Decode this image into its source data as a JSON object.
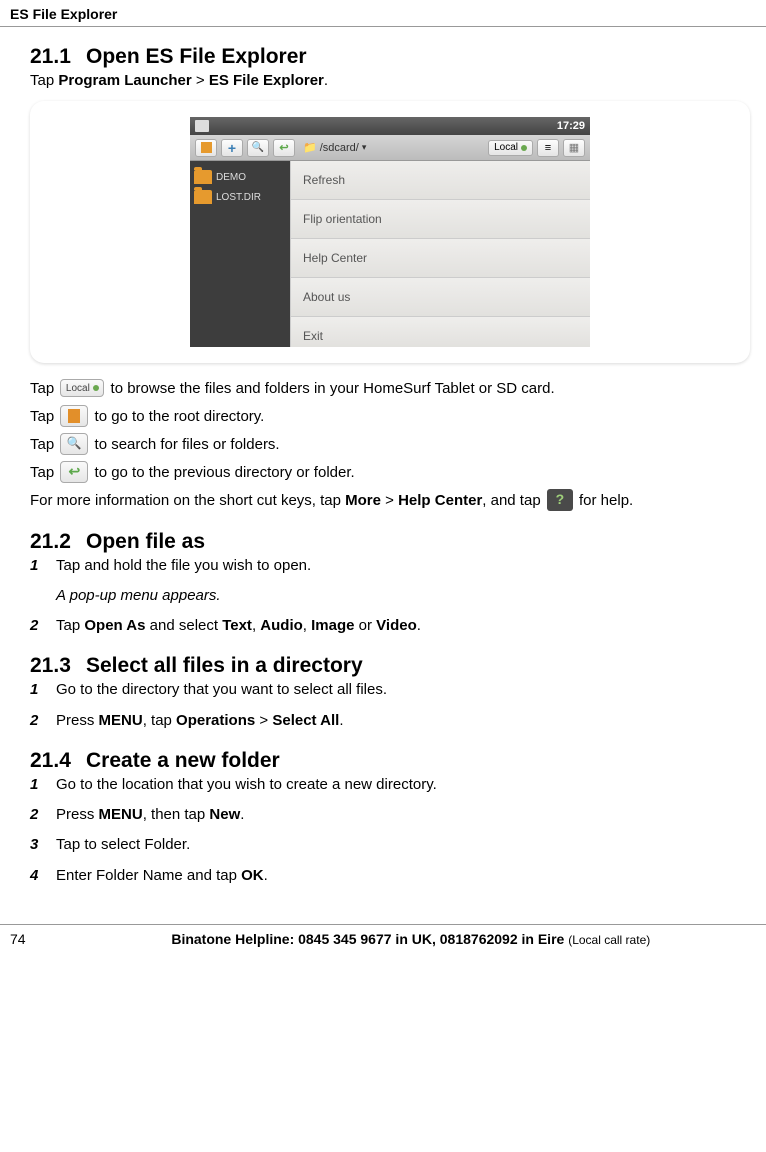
{
  "header": {
    "title": "ES File Explorer"
  },
  "sections": {
    "s1": {
      "num": "21.1",
      "title": "Open ES File Explorer",
      "intro_pre": "Tap ",
      "intro_b1": "Program Launcher",
      "intro_gt": " > ",
      "intro_b2": "ES File Explorer",
      "intro_post": "."
    },
    "s2": {
      "num": "21.2",
      "title": "Open file as",
      "steps": [
        {
          "n": "1",
          "text_pre": "Tap and hold the file you wish to open.",
          "sub": "A pop-up menu appears."
        },
        {
          "n": "2",
          "text_pre": "Tap ",
          "b1": "Open As",
          "mid1": " and select ",
          "b2": "Text",
          "mid2": ", ",
          "b3": "Audio",
          "mid3": ", ",
          "b4": "Image",
          "mid4": " or ",
          "b5": "Video",
          "post": "."
        }
      ]
    },
    "s3": {
      "num": "21.3",
      "title": "Select all files in a directory",
      "steps": [
        {
          "n": "1",
          "text_pre": "Go to the directory that you want to select all files."
        },
        {
          "n": "2",
          "text_pre": "Press ",
          "b1": "MENU",
          "mid1": ", tap ",
          "b2": "Operations",
          "mid2": " > ",
          "b3": "Select All",
          "post": "."
        }
      ]
    },
    "s4": {
      "num": "21.4",
      "title": "Create a new folder",
      "steps": [
        {
          "n": "1",
          "text_pre": "Go to the location that you wish to create a new directory."
        },
        {
          "n": "2",
          "text_pre": "Press ",
          "b1": "MENU",
          "mid1": ", then tap ",
          "b2": "New",
          "post": "."
        },
        {
          "n": "3",
          "text_pre": "Tap to select Folder."
        },
        {
          "n": "4",
          "text_pre": "Enter Folder Name and tap ",
          "b1": "OK",
          "post": "."
        }
      ]
    }
  },
  "iconparas": {
    "p1": {
      "pre": "Tap ",
      "post": " to browse the files and folders in your HomeSurf Tablet or SD card.",
      "localText": "Local"
    },
    "p2": {
      "pre": "Tap ",
      "post": " to go to the root directory."
    },
    "p3": {
      "pre": "Tap ",
      "post": " to search for files or folders."
    },
    "p4": {
      "pre": "Tap ",
      "post": " to go to the previous directory or folder."
    },
    "p5": {
      "pre": "For more information on the short cut keys, tap ",
      "b1": "More",
      "gt": " > ",
      "b2": "Help Center",
      "mid": ", and tap ",
      "post": " for help."
    }
  },
  "screenshot": {
    "time": "17:29",
    "path": "/sdcard/",
    "localLabel": "Local",
    "folders": [
      "DEMO",
      "LOST.DIR"
    ],
    "menu": [
      "Refresh",
      "Flip orientation",
      "Help Center",
      "About us",
      "Exit"
    ]
  },
  "footer": {
    "page": "74",
    "helpline_pre": "Binatone Helpline: 0845 345 9677 in UK, 0818762092 in Eire ",
    "helpline_small": "(Local call rate)"
  }
}
